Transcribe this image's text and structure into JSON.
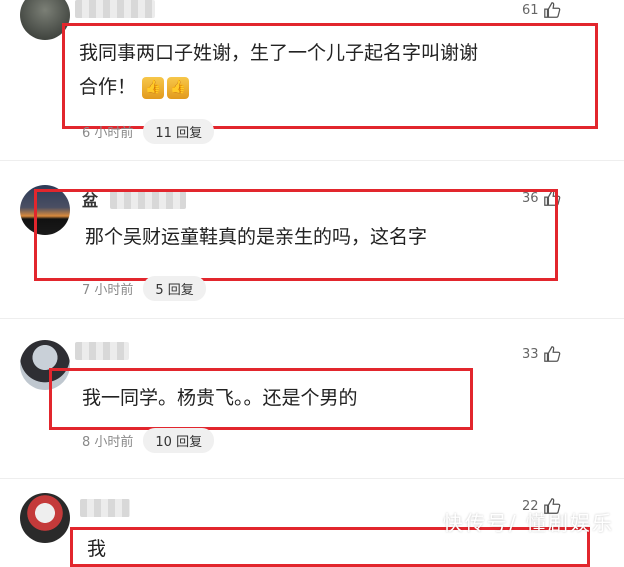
{
  "comments": [
    {
      "likes": "61",
      "text_line1": "我同事两口子姓谢，生了一个儿子起名字叫谢谢",
      "text_line2": "合作！",
      "time": "6 小时前",
      "replies": "11 回复"
    },
    {
      "username": "盆",
      "likes": "36",
      "text_line1": "那个吴财运童鞋真的是亲生的吗，这名字",
      "time": "7 小时前",
      "replies": "5 回复"
    },
    {
      "likes": "33",
      "text_line1": "我一同学。杨贵飞。。还是个男的",
      "time": "8 小时前",
      "replies": "10 回复"
    },
    {
      "likes": "22",
      "text_line1": "我"
    }
  ],
  "watermark": "快传号/ 懂剧娱乐"
}
